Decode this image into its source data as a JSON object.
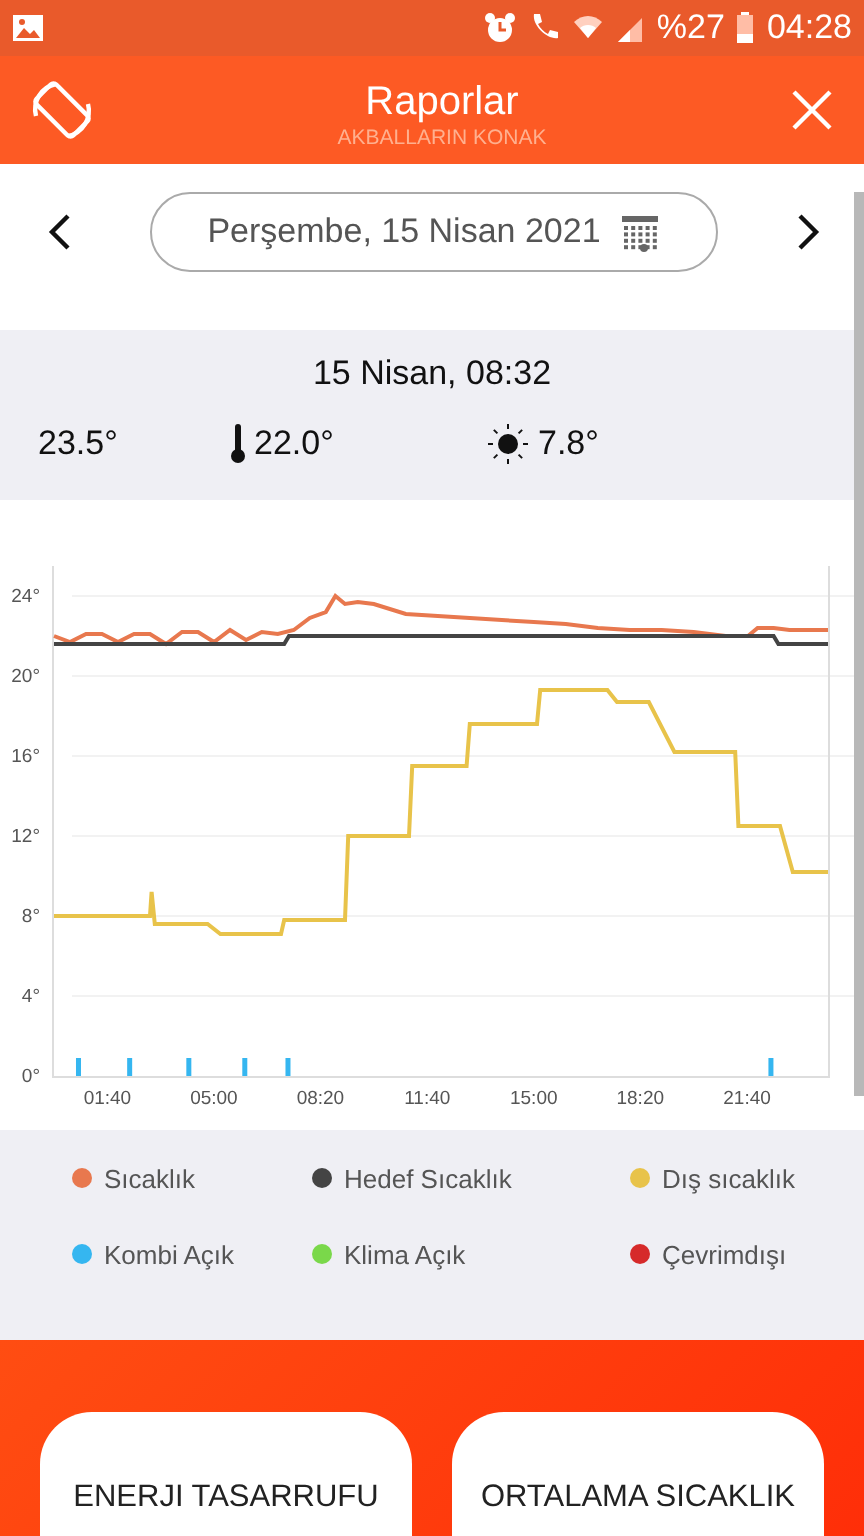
{
  "status_bar": {
    "battery_percent": "%27",
    "time": "04:28"
  },
  "header": {
    "title": "Raporlar",
    "subtitle": "AKBALLARIN KONAK"
  },
  "date_picker": {
    "value": "Perşembe, 15 Nisan 2021"
  },
  "reading": {
    "time": "15 Nisan, 08:32",
    "temperature": "23.5°",
    "target": "22.0°",
    "outdoor": "7.8°"
  },
  "chart": {
    "chart_data": {
      "type": "line",
      "xlim": [
        0,
        24.2
      ],
      "ylim": [
        0,
        25.5
      ],
      "grid": true,
      "yticks": [
        {
          "value": 0,
          "label": "0°"
        },
        {
          "value": 4,
          "label": "4°"
        },
        {
          "value": 8,
          "label": "8°"
        },
        {
          "value": 12,
          "label": "12°"
        },
        {
          "value": 16,
          "label": "16°"
        },
        {
          "value": 20,
          "label": "20°"
        },
        {
          "value": 24,
          "label": "24°"
        }
      ],
      "xticks": [
        {
          "value": 1.67,
          "label": "01:40"
        },
        {
          "value": 5,
          "label": "05:00"
        },
        {
          "value": 8.33,
          "label": "08:20"
        },
        {
          "value": 11.67,
          "label": "11:40"
        },
        {
          "value": 15,
          "label": "15:00"
        },
        {
          "value": 18.33,
          "label": "18:20"
        },
        {
          "value": 21.67,
          "label": "21:40"
        }
      ],
      "series": [
        {
          "name": "Sıcaklık",
          "color": "#e8784e",
          "type": "line",
          "x": [
            0,
            0.5,
            1,
            1.5,
            2,
            2.5,
            3,
            3.5,
            4,
            4.5,
            5,
            5.5,
            6,
            6.5,
            7,
            7.5,
            8,
            8.5,
            8.8,
            9.1,
            9.5,
            10,
            11,
            12,
            13,
            14,
            15,
            16,
            17,
            18,
            19,
            20,
            21,
            21.7,
            22,
            22.5,
            23,
            24.2
          ],
          "values": [
            22,
            21.7,
            22.1,
            22.1,
            21.7,
            22.1,
            22.1,
            21.6,
            22.2,
            22.2,
            21.7,
            22.3,
            21.8,
            22.2,
            22.1,
            22.3,
            22.9,
            23.2,
            24,
            23.6,
            23.7,
            23.6,
            23.1,
            23,
            22.9,
            22.8,
            22.7,
            22.6,
            22.4,
            22.3,
            22.3,
            22.2,
            22,
            22,
            22.4,
            22.4,
            22.3,
            22.3
          ]
        },
        {
          "name": "Hedef Sıcaklık",
          "color": "#444444",
          "type": "line",
          "x": [
            0,
            7.2,
            7.35,
            22.5,
            22.65,
            24.2
          ],
          "values": [
            21.6,
            21.6,
            22,
            22,
            21.6,
            21.6
          ]
        },
        {
          "name": "Dış sıcaklık",
          "color": "#e8c34a",
          "type": "line",
          "x": [
            0,
            3,
            3.05,
            3.15,
            4.8,
            5.2,
            7.1,
            7.2,
            9.1,
            9.2,
            11.1,
            11.2,
            12.9,
            13,
            15.1,
            15.2,
            17.3,
            17.6,
            18.6,
            19.4,
            21.3,
            21.4,
            22.7,
            23.1,
            24.2
          ],
          "values": [
            8,
            8,
            9.2,
            7.6,
            7.6,
            7.1,
            7.1,
            7.8,
            7.8,
            12,
            12,
            15.5,
            15.5,
            17.6,
            17.6,
            19.3,
            19.3,
            18.7,
            18.7,
            16.2,
            16.2,
            12.5,
            12.5,
            10.2,
            10.2
          ]
        },
        {
          "name": "Kombi Açık",
          "color": "#35b6f0",
          "type": "bar",
          "x": [
            0.75,
            2.35,
            4.2,
            5.95,
            7.3,
            22.4
          ],
          "values": [
            1,
            1,
            1,
            1,
            1,
            1
          ]
        }
      ]
    }
  },
  "legend": [
    {
      "label": "Klima Açık",
      "color": "#7ad84a"
    },
    {
      "label": "Çevrimdışı",
      "color": "#d62a2a"
    }
  ],
  "cards": [
    {
      "title": "ENERJI TASARRUFU"
    },
    {
      "title": "ORTALAMA SICAKLIK"
    }
  ]
}
